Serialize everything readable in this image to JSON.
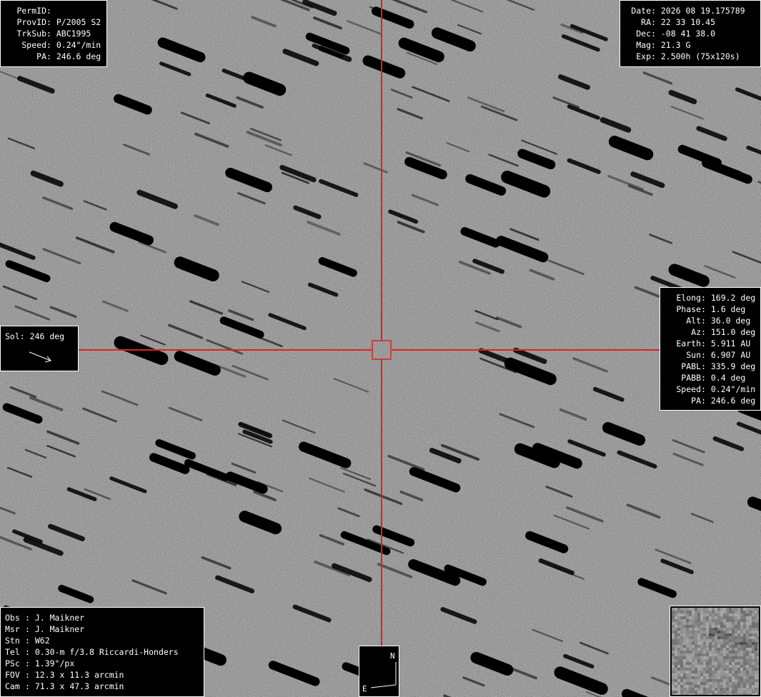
{
  "top_left": {
    "rows": [
      {
        "label": "PermID",
        "value": ""
      },
      {
        "label": "ProvID",
        "value": "P/2005 S2"
      },
      {
        "label": "TrkSub",
        "value": "ABC1995"
      },
      {
        "label": "Speed",
        "value": "0.24\"/min"
      },
      {
        "label": "PA",
        "value": "246.6 deg"
      }
    ]
  },
  "top_right": {
    "rows": [
      {
        "label": "Date",
        "value": "2026 08 19.175789"
      },
      {
        "label": "RA",
        "value": "22 33 10.45"
      },
      {
        "label": "Dec",
        "value": "-08 41 38.0"
      },
      {
        "label": "Mag",
        "value": "21.3 G"
      },
      {
        "label": "Exp",
        "value": "2.500h (75x120s)"
      }
    ]
  },
  "right": {
    "rows": [
      {
        "label": "Elong",
        "value": "169.2 deg"
      },
      {
        "label": "Phase",
        "value": "1.6 deg"
      },
      {
        "label": "Alt",
        "value": "36.0 deg"
      },
      {
        "label": "Az",
        "value": "151.0 deg"
      },
      {
        "label": "Earth",
        "value": "5.911 AU"
      },
      {
        "label": "Sun",
        "value": "6.907 AU"
      },
      {
        "label": "PABL",
        "value": "335.9 deg"
      },
      {
        "label": "PABB",
        "value": "0.4 deg"
      },
      {
        "label": "Speed",
        "value": "0.24\"/min"
      },
      {
        "label": "PA",
        "value": "246.6 deg"
      }
    ]
  },
  "sol": {
    "label": "Sol",
    "value": "246 deg",
    "arrow_icon": "sun-direction-arrow-icon"
  },
  "bottom_left": {
    "rows": [
      {
        "label": "Obs",
        "value": "J. Maikner"
      },
      {
        "label": "Msr",
        "value": "J. Maikner"
      },
      {
        "label": "Stn",
        "value": "W62"
      },
      {
        "label": "Tel",
        "value": "0.30-m f/3.8 Riccardi-Honders"
      },
      {
        "label": "PSc",
        "value": "1.39\"/px"
      },
      {
        "label": "FOV",
        "value": "12.3 x 11.3 arcmin"
      },
      {
        "label": "Cam",
        "value": "71.3 x 47.3 arcmin"
      }
    ]
  },
  "compass": {
    "north": "N",
    "east": "E"
  },
  "colors": {
    "crosshair": "#e02020",
    "panel_bg": "#000000",
    "panel_text": "#ffffff",
    "sky": "#7d7d7d"
  }
}
